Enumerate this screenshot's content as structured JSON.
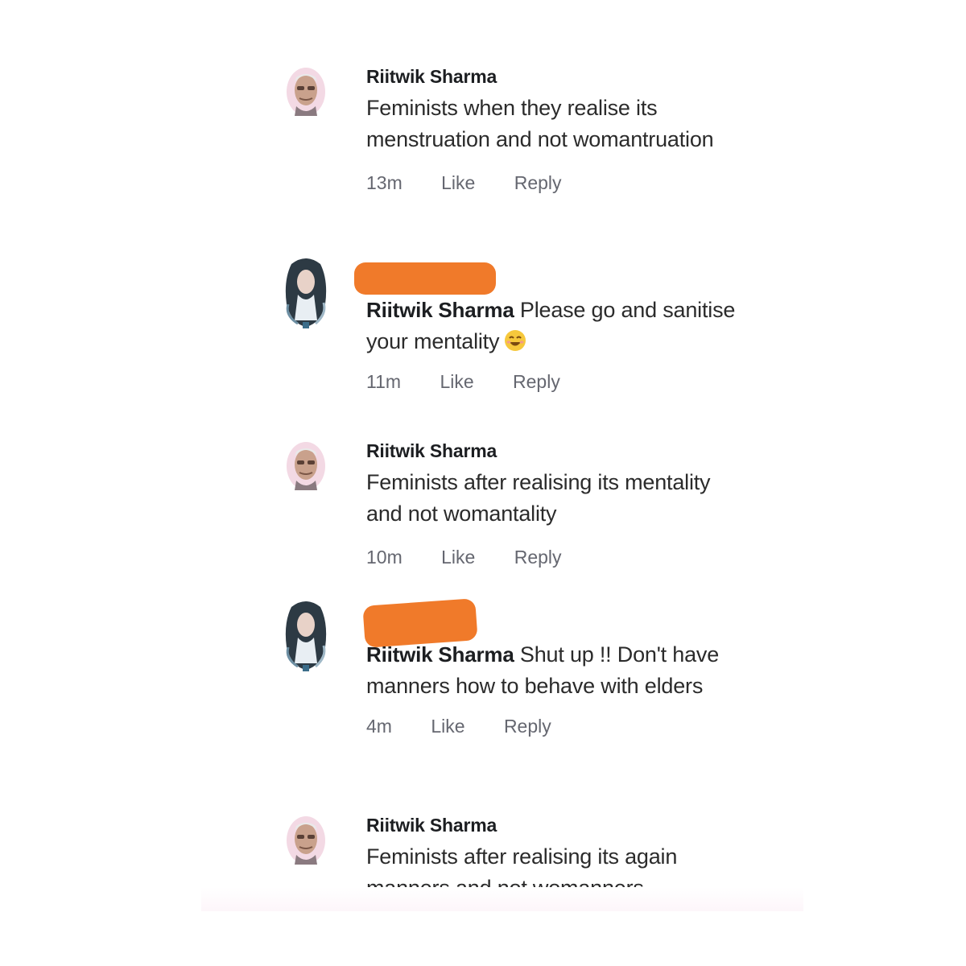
{
  "comments": [
    {
      "author": "Riitwik Sharma",
      "text": "Feminists when they realise its menstruation and not womantruation",
      "time": "13m",
      "like_label": "Like",
      "reply_label": "Reply",
      "avatar_icon": "older-man-avatar"
    },
    {
      "author": "",
      "mention": "Riitwik Sharma",
      "text": " Please go and sanitise your mentality",
      "emoji": "smiling-face-emoji",
      "time": "11m",
      "like_label": "Like",
      "reply_label": "Reply",
      "avatar_icon": "woman-avatar",
      "redaction_color": "#f07a2a"
    },
    {
      "author": "Riitwik Sharma",
      "text": "Feminists after realising its mentality and not womantality",
      "time": "10m",
      "like_label": "Like",
      "reply_label": "Reply",
      "avatar_icon": "older-man-avatar"
    },
    {
      "author": "",
      "mention": "Riitwik Sharma",
      "text": " Shut up !! Don't have manners how to behave with elders",
      "time": "4m",
      "like_label": "Like",
      "reply_label": "Reply",
      "avatar_icon": "woman-avatar",
      "redaction_color": "#f07a2a"
    },
    {
      "author": "Riitwik Sharma",
      "text": "Feminists after realising its again manners and not womanners",
      "avatar_icon": "older-man-avatar"
    }
  ]
}
